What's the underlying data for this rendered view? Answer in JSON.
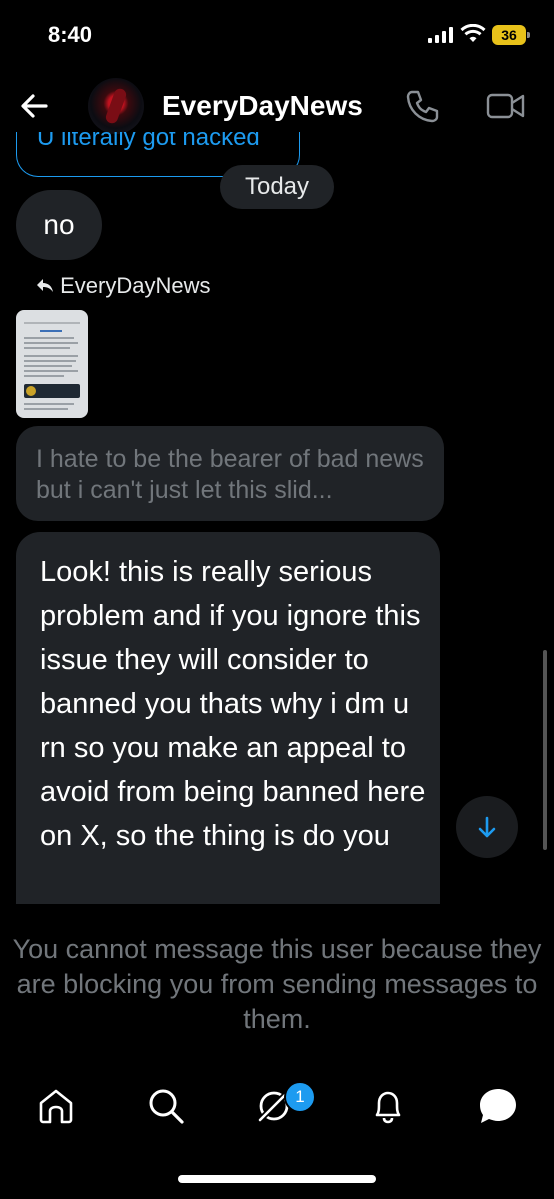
{
  "status_bar": {
    "time": "8:40",
    "battery": "36"
  },
  "header": {
    "back_icon": "arrow-left-icon",
    "contact_name": "EveryDayNews",
    "call_icon": "phone-icon",
    "video_icon": "video-icon"
  },
  "messages": {
    "previous_partial": "U literally got hacked",
    "date_divider": "Today",
    "sent_no": "no",
    "reply_to_label": "EveryDayNews",
    "quoted_preview": "I hate to be the bearer of bad news but i can't just let this slid...",
    "long_message": "Look! this is really serious problem and if you ignore this issue they will consider to banned you thats why i dm u rn so you make an appeal to avoid from being banned here on X, so the thing is do you"
  },
  "blocked_notice": "You cannot message this user because they are blocking you from sending messages to them.",
  "nav": {
    "items": [
      "home-icon",
      "search-icon",
      "grok-icon",
      "notifications-icon",
      "messages-icon"
    ],
    "badge_count": "1"
  },
  "colors": {
    "accent": "#1d9bf0",
    "bubble": "#202327",
    "muted": "#71767b",
    "battery": "#e8c21a"
  }
}
